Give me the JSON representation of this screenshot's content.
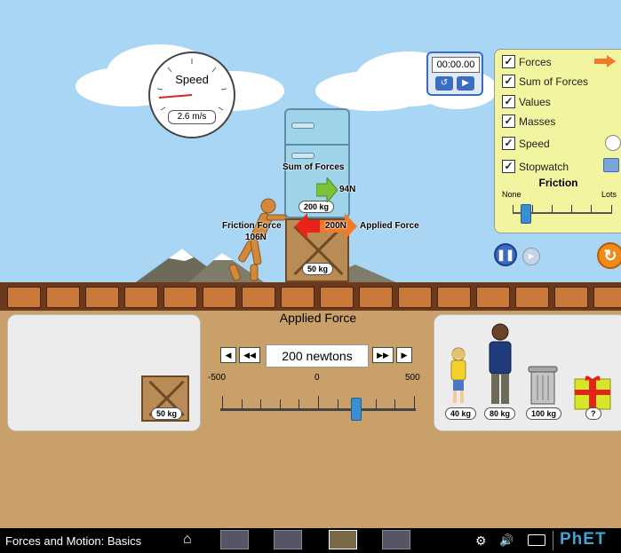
{
  "speedometer": {
    "title": "Speed",
    "value": "2.6 m/s"
  },
  "stopwatch": {
    "time": "00:00.00"
  },
  "forces": {
    "sum_label": "Sum of Forces",
    "sum_value": "94N",
    "friction_label": "Friction Force",
    "friction_value": "106N",
    "applied_label": "Applied Force",
    "applied_value": "200N"
  },
  "stack_masses": {
    "top": "200 kg",
    "bottom": "50 kg"
  },
  "control_panel": {
    "checkboxes": [
      {
        "label": "Forces",
        "checked": true
      },
      {
        "label": "Sum of Forces",
        "checked": true
      },
      {
        "label": "Values",
        "checked": true
      },
      {
        "label": "Masses",
        "checked": true
      },
      {
        "label": "Speed",
        "checked": true
      },
      {
        "label": "Stopwatch",
        "checked": true
      }
    ],
    "friction_title": "Friction",
    "friction_min": "None",
    "friction_max": "Lots"
  },
  "applied_force": {
    "title": "Applied Force",
    "value_display": "200 newtons",
    "value": 200,
    "min": -500,
    "max": 500,
    "min_label": "-500",
    "zero_label": "0",
    "max_label": "500"
  },
  "left_items": [
    {
      "mass": "50 kg"
    }
  ],
  "right_items": [
    {
      "mass": "40 kg"
    },
    {
      "mass": "80 kg"
    },
    {
      "mass": "100 kg"
    },
    {
      "mass": "?"
    }
  ],
  "navbar": {
    "title": "Forces and Motion: Basics",
    "brand": "PhET"
  },
  "colors": {
    "sky": "#a9d6f5",
    "ground_panel": "#c9a06a",
    "control_panel": "#f2f4a0",
    "friction_arrow": "#e8241a",
    "applied_arrow": "#f07a2a",
    "sum_arrow": "#7ec23a"
  }
}
